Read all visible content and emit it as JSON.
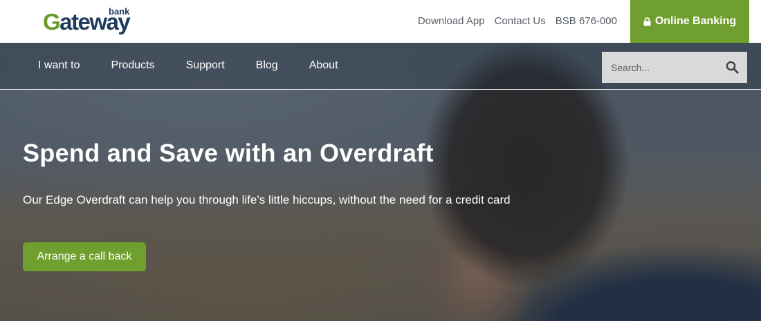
{
  "brand": {
    "logo_initial": "G",
    "logo_rest": "ateway",
    "logo_bank": "bank",
    "colors": {
      "navy": "#1d3a5c",
      "green": "#6f9f2e"
    }
  },
  "topbar": {
    "links": [
      {
        "label": "Download App"
      },
      {
        "label": "Contact Us"
      },
      {
        "label": "BSB 676-000"
      }
    ],
    "online_banking": {
      "label": "Online Banking",
      "icon": "lock-icon"
    }
  },
  "nav": {
    "items": [
      {
        "label": "I want to"
      },
      {
        "label": "Products"
      },
      {
        "label": "Support"
      },
      {
        "label": "Blog"
      },
      {
        "label": "About"
      }
    ],
    "search": {
      "placeholder": "Search...",
      "value": "",
      "icon": "search-icon"
    }
  },
  "hero": {
    "title": "Spend and Save with an Overdraft",
    "subtitle": "Our Edge Overdraft can help you through life’s little hiccups, without the need for a credit card",
    "cta_label": "Arrange a call back"
  }
}
